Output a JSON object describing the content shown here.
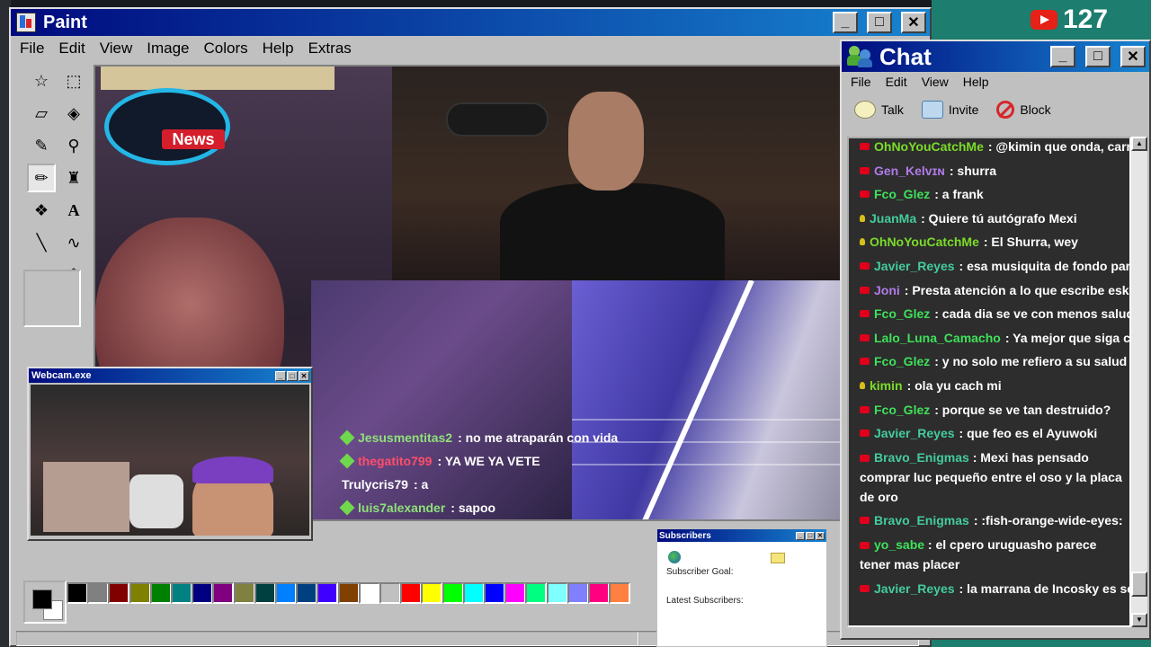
{
  "stream": {
    "viewer_count": "127"
  },
  "paint": {
    "title": "Paint",
    "menu": [
      "File",
      "Edit",
      "View",
      "Image",
      "Colors",
      "Help",
      "Extras"
    ],
    "tools": [
      "free-select",
      "rect-select",
      "eraser",
      "fill",
      "color-picker",
      "magnifier",
      "pencil",
      "brush",
      "airbrush",
      "text",
      "line",
      "curve",
      "rectangle",
      "polygon",
      "ellipse",
      "rounded-rect"
    ],
    "selected_tool": "pencil",
    "palette": [
      "#000000",
      "#808080",
      "#800000",
      "#808000",
      "#008000",
      "#008080",
      "#000080",
      "#800080",
      "#808040",
      "#004040",
      "#0080ff",
      "#004080",
      "#4000ff",
      "#804000",
      "#ffffff",
      "#c0c0c0",
      "#ff0000",
      "#ffff00",
      "#00ff00",
      "#00ffff",
      "#0000ff",
      "#ff00ff",
      "#00ff80",
      "#80ffff",
      "#8080ff",
      "#ff0080",
      "#ff8040"
    ],
    "canvas": {
      "news_label": "News",
      "overlay_chat": [
        {
          "user": "Jesusmentitas2",
          "text": ": no me atraparán con vida",
          "user_color": "green",
          "diamond": true
        },
        {
          "user": "thegatito799",
          "text": ": YA WE YA VETE",
          "user_color": "red",
          "diamond": true
        },
        {
          "user": "Trulycris79",
          "text": ": a",
          "user_color": "white",
          "diamond": false
        },
        {
          "user": "luis7alexander",
          "text": ": sapoo",
          "user_color": "green",
          "diamond": true
        }
      ]
    }
  },
  "webcam": {
    "title": "Webcam.exe"
  },
  "subscribers": {
    "title": "Subscribers",
    "goal_label": "Subscriber Goal:",
    "latest_label": "Latest Subscribers:"
  },
  "chat": {
    "title": "Chat",
    "menu": [
      "File",
      "Edit",
      "View",
      "Help"
    ],
    "toolbar": {
      "talk": "Talk",
      "invite": "Invite",
      "block": "Block"
    },
    "messages": [
      {
        "user": "OhNoYouCatchMe",
        "text": ": @kimin que onda, carnal",
        "color": "u-lime",
        "badge": "live"
      },
      {
        "user": "Gen_Kelvɪɴ",
        "text": ": shurra",
        "color": "u-purple",
        "badge": "live"
      },
      {
        "user": "Fco_Glez",
        "text": ": a frank",
        "color": "u-green",
        "badge": "live"
      },
      {
        "user": "JuanMa",
        "text": ": Quiere tú autógrafo Mexi",
        "color": "u-teal",
        "badge": "bulb"
      },
      {
        "user": "OhNoYouCatchMe",
        "text": ": El Shurra, wey",
        "color": "u-lime",
        "badge": "bulb"
      },
      {
        "user": "Javier_Reyes",
        "text": ": esa musiquita de fondo parece de",
        "color": "u-teal",
        "badge": "live"
      },
      {
        "user": "Joni",
        "text": ": Presta atención a lo que escribe eski",
        "color": "u-purple",
        "badge": "live"
      },
      {
        "user": "Fco_Glez",
        "text": ": cada dia se ve con menos salud guib",
        "color": "u-green",
        "badge": "live"
      },
      {
        "user": "Lalo_Luna_Camacho",
        "text": ": Ya mejor que siga con su",
        "color": "u-green",
        "badge": "live"
      },
      {
        "user": "Fco_Glez",
        "text": ": y no solo me refiero a su salud ment",
        "color": "u-green",
        "badge": "live"
      },
      {
        "user": "kimin",
        "text": ": ola yu cach mi",
        "color": "u-lime",
        "badge": "bulb"
      },
      {
        "user": "Fco_Glez",
        "text": ": porque se ve tan destruido?",
        "color": "u-green",
        "badge": "live"
      },
      {
        "user": "Javier_Reyes",
        "text": ": que feo es el Ayuwoki",
        "color": "u-teal",
        "badge": "live"
      },
      {
        "user": "Bravo_Enigmas",
        "text": ": Mexi has pensado comprar luc pequeño entre el oso y la placa de oro",
        "color": "u-teal",
        "badge": "live",
        "wrap": true
      },
      {
        "user": "Bravo_Enigmas",
        "text": ": :fish-orange-wide-eyes:",
        "color": "u-teal",
        "badge": "live"
      },
      {
        "user": "yo_sabe",
        "text": ": el cpero uruguasho parece tener mas placer",
        "color": "u-green",
        "badge": "live",
        "wrap": true
      },
      {
        "user": "Javier_Reyes",
        "text": ": la marrana de Incosky es seguid",
        "color": "u-teal",
        "badge": "live"
      }
    ]
  },
  "colors": {
    "title_gradient_start": "#000a7e",
    "title_gradient_end": "#1784d0",
    "window_face": "#c0c0c0",
    "chat_background": "#2d2d2d",
    "youtube_red": "#e62117"
  }
}
